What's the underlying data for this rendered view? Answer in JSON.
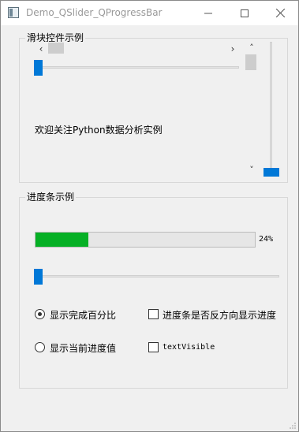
{
  "window": {
    "title": "Demo_QSlider_QProgressBar",
    "minimize_icon": "minimize-icon",
    "maximize_icon": "maximize-icon",
    "close_icon": "close-icon"
  },
  "slider_group": {
    "title": "滑块控件示例",
    "label": "欢迎关注Python数据分析实例",
    "h_scrollbar": {
      "left_arrow": "‹",
      "right_arrow": "›",
      "value_fraction": 0.0
    },
    "v_scrollbar": {
      "up_arrow": "˄",
      "down_arrow": "˅",
      "value_fraction": 0.0
    },
    "h_slider": {
      "value_fraction": 0.0
    },
    "v_slider": {
      "value_fraction": 0.0
    }
  },
  "progress_group": {
    "title": "进度条示例",
    "progress": {
      "value": 24,
      "text": "24%"
    },
    "slider": {
      "value_fraction": 0.0
    },
    "radio_show_percent": {
      "label": "显示完成百分比",
      "checked": true
    },
    "radio_show_value": {
      "label": "显示当前进度值",
      "checked": false
    },
    "check_inverted": {
      "label": "进度条是否反方向显示进度",
      "checked": false
    },
    "check_text_visible": {
      "label": "textVisible",
      "checked": false
    }
  },
  "colors": {
    "accent": "#0078d7",
    "progress_fill": "#06b025"
  }
}
